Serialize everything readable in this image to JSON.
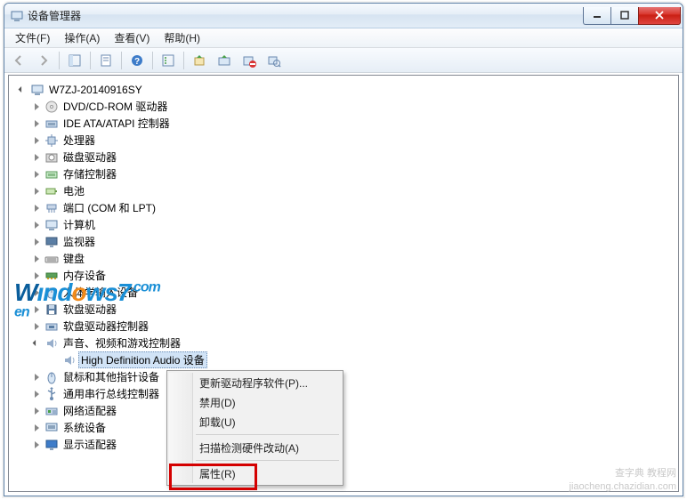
{
  "window": {
    "title": "设备管理器"
  },
  "menubar": {
    "file": "文件(F)",
    "action": "操作(A)",
    "view": "查看(V)",
    "help": "帮助(H)"
  },
  "toolbar": {
    "icons": [
      "back",
      "forward",
      "up-list",
      "detail",
      "help",
      "views",
      "properties",
      "refresh",
      "remove",
      "scan"
    ]
  },
  "tree": {
    "root": "W7ZJ-20140916SY",
    "nodes": [
      {
        "label": "DVD/CD-ROM 驱动器",
        "icon": "dvd"
      },
      {
        "label": "IDE ATA/ATAPI 控制器",
        "icon": "ide"
      },
      {
        "label": "处理器",
        "icon": "cpu"
      },
      {
        "label": "磁盘驱动器",
        "icon": "disk"
      },
      {
        "label": "存储控制器",
        "icon": "storage"
      },
      {
        "label": "电池",
        "icon": "battery"
      },
      {
        "label": "端口 (COM 和 LPT)",
        "icon": "port"
      },
      {
        "label": "计算机",
        "icon": "computer"
      },
      {
        "label": "监视器",
        "icon": "monitor"
      },
      {
        "label": "键盘",
        "icon": "keyboard"
      },
      {
        "label": "内存设备",
        "icon": "memory"
      },
      {
        "label": "人体学输入设备",
        "icon": "hid"
      },
      {
        "label": "软盘驱动器",
        "icon": "floppy"
      },
      {
        "label": "软盘驱动器控制器",
        "icon": "floppyctrl"
      },
      {
        "label": "声音、视频和游戏控制器",
        "icon": "sound",
        "expanded": true
      }
    ],
    "sound_child": "High Definition Audio 设备",
    "nodes_after": [
      {
        "label": "鼠标和其他指针设备",
        "icon": "mouse"
      },
      {
        "label": "通用串行总线控制器",
        "icon": "usb"
      },
      {
        "label": "网络适配器",
        "icon": "network"
      },
      {
        "label": "系统设备",
        "icon": "system"
      },
      {
        "label": "显示适配器",
        "icon": "display"
      }
    ]
  },
  "context_menu": {
    "update_driver": "更新驱动程序软件(P)...",
    "disable": "禁用(D)",
    "uninstall": "卸载(U)",
    "scan_changes": "扫描检测硬件改动(A)",
    "properties": "属性(R)"
  },
  "watermark": {
    "line1": "查字典 教程网",
    "line2": "jiaocheng.chazidian.com"
  }
}
